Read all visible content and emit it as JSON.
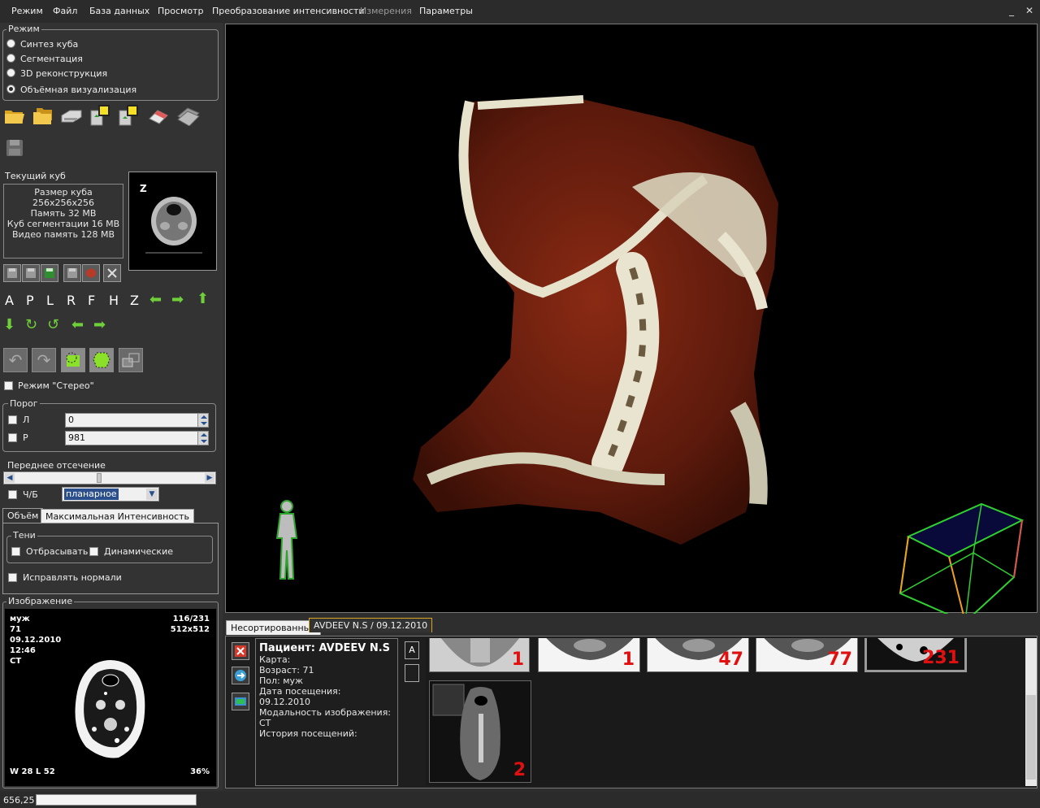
{
  "menu": {
    "items": [
      "Режим",
      "Файл",
      "База данных",
      "Просмотр",
      "Преобразование интенсивности",
      "Измерения",
      "Параметры"
    ],
    "minimize": "_",
    "close": "✕"
  },
  "mode": {
    "title": "Режим",
    "options": [
      "Синтез куба",
      "Сегментация",
      "3D реконструкция",
      "Объёмная визуализация"
    ],
    "selected_index": 3
  },
  "toolbar_icons": [
    "folder-open-icon",
    "folders-icon",
    "scanner-icon",
    "recycle-yellow-icon",
    "recycle-green-icon",
    "eraser-icon",
    "card-icon",
    "disk-icon"
  ],
  "current_cube": {
    "title": "Текущий куб",
    "lines": [
      "Размер куба 256x256x256",
      "Память 32 MB",
      "Куб сегментации 16 MB",
      "Видео память 128 MB"
    ],
    "preview_label": "Z"
  },
  "orientation": {
    "letters": [
      "A",
      "P",
      "L",
      "R",
      "F",
      "H",
      "Z"
    ]
  },
  "stereo": {
    "label": "Режим \"Стерео\"",
    "checked": false
  },
  "threshold": {
    "title": "Порог",
    "left_label": "Л",
    "left_value": "0",
    "right_label": "Р",
    "right_value": "981"
  },
  "clipping": {
    "title": "Переднее отсечение",
    "slider_fraction": 0.43,
    "bw_label": "Ч/Б",
    "mode_value": "планарное"
  },
  "render_tabs": {
    "tabs": [
      "Объём",
      "Максимальная Интенсивность"
    ],
    "active": 0,
    "shadows_title": "Тени",
    "cast_label": "Отбрасывать",
    "dynamic_label": "Динамические",
    "normals_label": "Исправлять нормали"
  },
  "image_panel": {
    "title": "Изображение",
    "sex": "муж",
    "age": "71",
    "date": "09.12.2010",
    "time": "12:46",
    "modality": "CT",
    "slice": "116/231",
    "resolution": "512x512",
    "window": "W 28 L 52",
    "zoom": "36%"
  },
  "series_tabs": {
    "tabs": [
      "Несортированные",
      "AVDEEV N.S / 09.12.2010"
    ],
    "active": 1
  },
  "patient": {
    "name_line": "Пациент: AVDEEV N.S",
    "card": "Карта:",
    "age": "Возраст: 71",
    "sex": "Пол: муж",
    "visit": "Дата посещения: 09.12.2010",
    "modality": "Модальность изображения: CT",
    "history": "История посещений:"
  },
  "series_side": {
    "a_label": "A"
  },
  "thumbnails": [
    {
      "count": "1"
    },
    {
      "count": "1"
    },
    {
      "count": "47"
    },
    {
      "count": "77"
    },
    {
      "count": "231"
    },
    {
      "count": "2"
    }
  ],
  "status": {
    "coords": "656,25"
  },
  "colors": {
    "accent_green": "#6fcf3a",
    "thumb_number": "#e01010",
    "bone": "#e8e4cf",
    "tissue": "#6b1f10"
  }
}
